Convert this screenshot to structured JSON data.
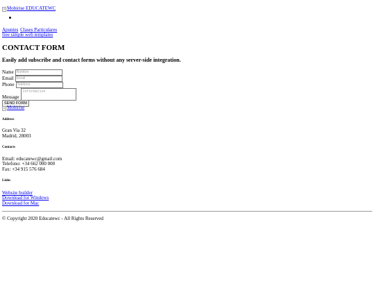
{
  "header": {
    "brand_alt": "Mobirise EDUCATEWC",
    "nav": [
      "Apuntes",
      "Clases Particulares"
    ],
    "free_templates_link": "free simple web templates"
  },
  "form": {
    "title": "CONTACT FORM",
    "subtitle": "Easily add subscribe and contact forms without any server-side integration.",
    "name_label": "Name",
    "name_placeholder": "Nombre",
    "email_label": "Email",
    "email_placeholder": "Email",
    "phone_label": "Phone",
    "phone_placeholder": "Telefono",
    "message_label": "Message",
    "message_placeholder": "Informacion",
    "send_label": "SEND FORM"
  },
  "footer": {
    "logo_alt": "Mobirise",
    "address": {
      "heading": "Address",
      "line1": "Gran Via 32",
      "line2": "Madrid, 28003"
    },
    "contacts": {
      "heading": "Contacts",
      "email": "Email: educatewc@gmail.com",
      "phone": "Telefono: +34 662 000 000",
      "fax": "Fax: +34 915 576 684"
    },
    "links": {
      "heading": "Links",
      "items": [
        "Website builder",
        "Download for Windows",
        "Download for Mac"
      ]
    },
    "copyright": "© Copyright 2020 Educatewc - All Rights Reserved"
  }
}
